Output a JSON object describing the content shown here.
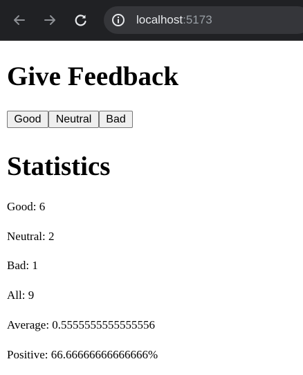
{
  "browser": {
    "url_host": "localhost",
    "url_port": ":5173",
    "icons": [
      "back-arrow-icon",
      "forward-arrow-icon",
      "reload-icon",
      "site-info-icon"
    ]
  },
  "page": {
    "title": "Give Feedback",
    "buttons": {
      "good": "Good",
      "neutral": "Neutral",
      "bad": "Bad"
    },
    "statistics_title": "Statistics",
    "stats": {
      "good": "Good: 6",
      "neutral": "Neutral: 2",
      "bad": "Bad: 1",
      "all": "All: 9",
      "average": "Average: 0.5555555555555556",
      "positive": "Positive: 66.66666666666666%"
    }
  }
}
